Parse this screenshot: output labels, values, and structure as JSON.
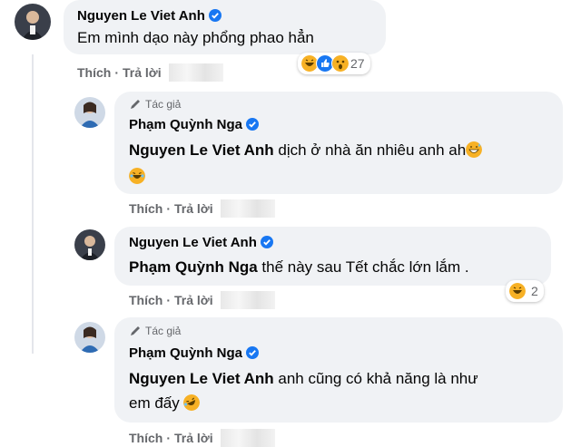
{
  "comments": [
    {
      "author_name": "Nguyen Le Viet Anh",
      "text": "Em mình dạo này phổng phao hẳn",
      "actions": {
        "like": "Thích",
        "reply": "Trả lời",
        "separator": "·"
      },
      "reaction_count": "27",
      "reaction_icons": [
        "haha-icon",
        "like-icon",
        "wow-icon"
      ]
    },
    {
      "author_badge": "Tác giả",
      "author_name": "Phạm Quỳnh Nga",
      "mention": "Nguyen Le Viet Anh",
      "text_line1": " dịch ở nhà ăn nhiêu anh ah",
      "actions": {
        "like": "Thích",
        "reply": "Trả lời",
        "separator": "·"
      }
    },
    {
      "author_name": "Nguyen Le Viet Anh",
      "mention": "Phạm Quỳnh Nga",
      "text": " thế này sau Tết chắc lớn lắm .",
      "actions": {
        "like": "Thích",
        "reply": "Trả lời",
        "separator": "·"
      },
      "reaction_count": "2",
      "reaction_icons": [
        "haha-icon"
      ]
    },
    {
      "author_badge": "Tác giả",
      "author_name": "Phạm Quỳnh Nga",
      "mention": "Nguyen Le Viet Anh",
      "text_line1": " anh cũng có khả năng là như",
      "text_line2": "em đấy",
      "actions": {
        "like": "Thích",
        "reply": "Trả lời",
        "separator": "·"
      }
    }
  ],
  "colors": {
    "bubble": "#f0f2f5",
    "secondary_text": "#65676b",
    "verified_blue": "#1877f2",
    "emoji_yellow": "#f7b125"
  }
}
